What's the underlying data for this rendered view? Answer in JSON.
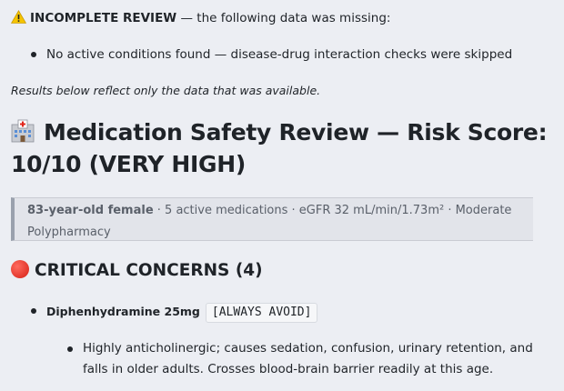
{
  "warning": {
    "icon": "warning-icon",
    "label": "INCOMPLETE REVIEW",
    "text": " — the following data was missing:",
    "items": [
      "No active conditions found — disease-drug interaction checks were skipped"
    ]
  },
  "note": "Results below reflect only the data that was available.",
  "title": {
    "icon": "hospital-icon",
    "text": "Medication Safety Review — Risk Score: 10/10 (VERY HIGH)"
  },
  "summary": {
    "patient": "83-year-old female",
    "details": " · 5 active medications · eGFR 32 mL/min/1.73m² · Moderate Polypharmacy"
  },
  "critical": {
    "icon": "red-circle-icon",
    "heading": "CRITICAL CONCERNS (4)",
    "items": [
      {
        "drug": "Diphenhydramine 25mg",
        "tag": "[ALWAYS AVOID]",
        "reasons": [
          "Highly anticholinergic; causes sedation, confusion, urinary retention, and falls in older adults. Crosses blood-brain barrier readily at this age."
        ]
      }
    ]
  },
  "colors": {
    "background": "#eceef3",
    "critical_red": "#d61f15",
    "summary_border": "#9aa1ad"
  }
}
